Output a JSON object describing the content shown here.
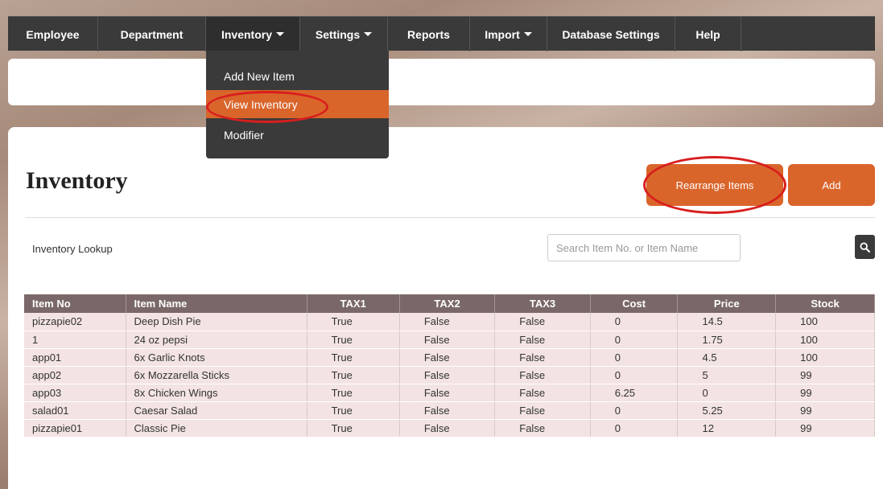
{
  "nav": {
    "items": [
      {
        "label": "Employee"
      },
      {
        "label": "Department"
      },
      {
        "label": "Inventory"
      },
      {
        "label": "Settings"
      },
      {
        "label": "Reports"
      },
      {
        "label": "Import"
      },
      {
        "label": "Database Settings"
      },
      {
        "label": "Help"
      }
    ]
  },
  "dropdown": {
    "items": [
      {
        "label": "Add New Item"
      },
      {
        "label": "View Inventory"
      },
      {
        "label": "Modifier"
      }
    ]
  },
  "page": {
    "title": "Inventory",
    "rearrange_label": "Rearrange Items",
    "add_label": "Add",
    "lookup_label": "Inventory Lookup",
    "search_placeholder": "Search Item No. or Item Name"
  },
  "table": {
    "headers": [
      "Item No",
      "Item Name",
      "TAX1",
      "TAX2",
      "TAX3",
      "Cost",
      "Price",
      "Stock"
    ],
    "rows": [
      [
        "pizzapie02",
        "Deep Dish Pie",
        "True",
        "False",
        "False",
        "0",
        "14.5",
        "100"
      ],
      [
        "1",
        "24 oz pepsi",
        "True",
        "False",
        "False",
        "0",
        "1.75",
        "100"
      ],
      [
        "app01",
        "6x Garlic Knots",
        "True",
        "False",
        "False",
        "0",
        "4.5",
        "100"
      ],
      [
        "app02",
        "6x Mozzarella Sticks",
        "True",
        "False",
        "False",
        "0",
        "5",
        "99"
      ],
      [
        "app03",
        "8x Chicken Wings",
        "True",
        "False",
        "False",
        "6.25",
        "0",
        "99"
      ],
      [
        "salad01",
        "Caesar Salad",
        "True",
        "False",
        "False",
        "0",
        "5.25",
        "99"
      ],
      [
        "pizzapie01",
        "Classic Pie",
        "True",
        "False",
        "False",
        "0",
        "12",
        "99"
      ]
    ]
  },
  "colors": {
    "accent": "#d9652b",
    "navbar": "#3a3a3a",
    "table_header": "#7a6868",
    "table_row": "#f3e3e3",
    "annotation": "#d81e1e"
  }
}
